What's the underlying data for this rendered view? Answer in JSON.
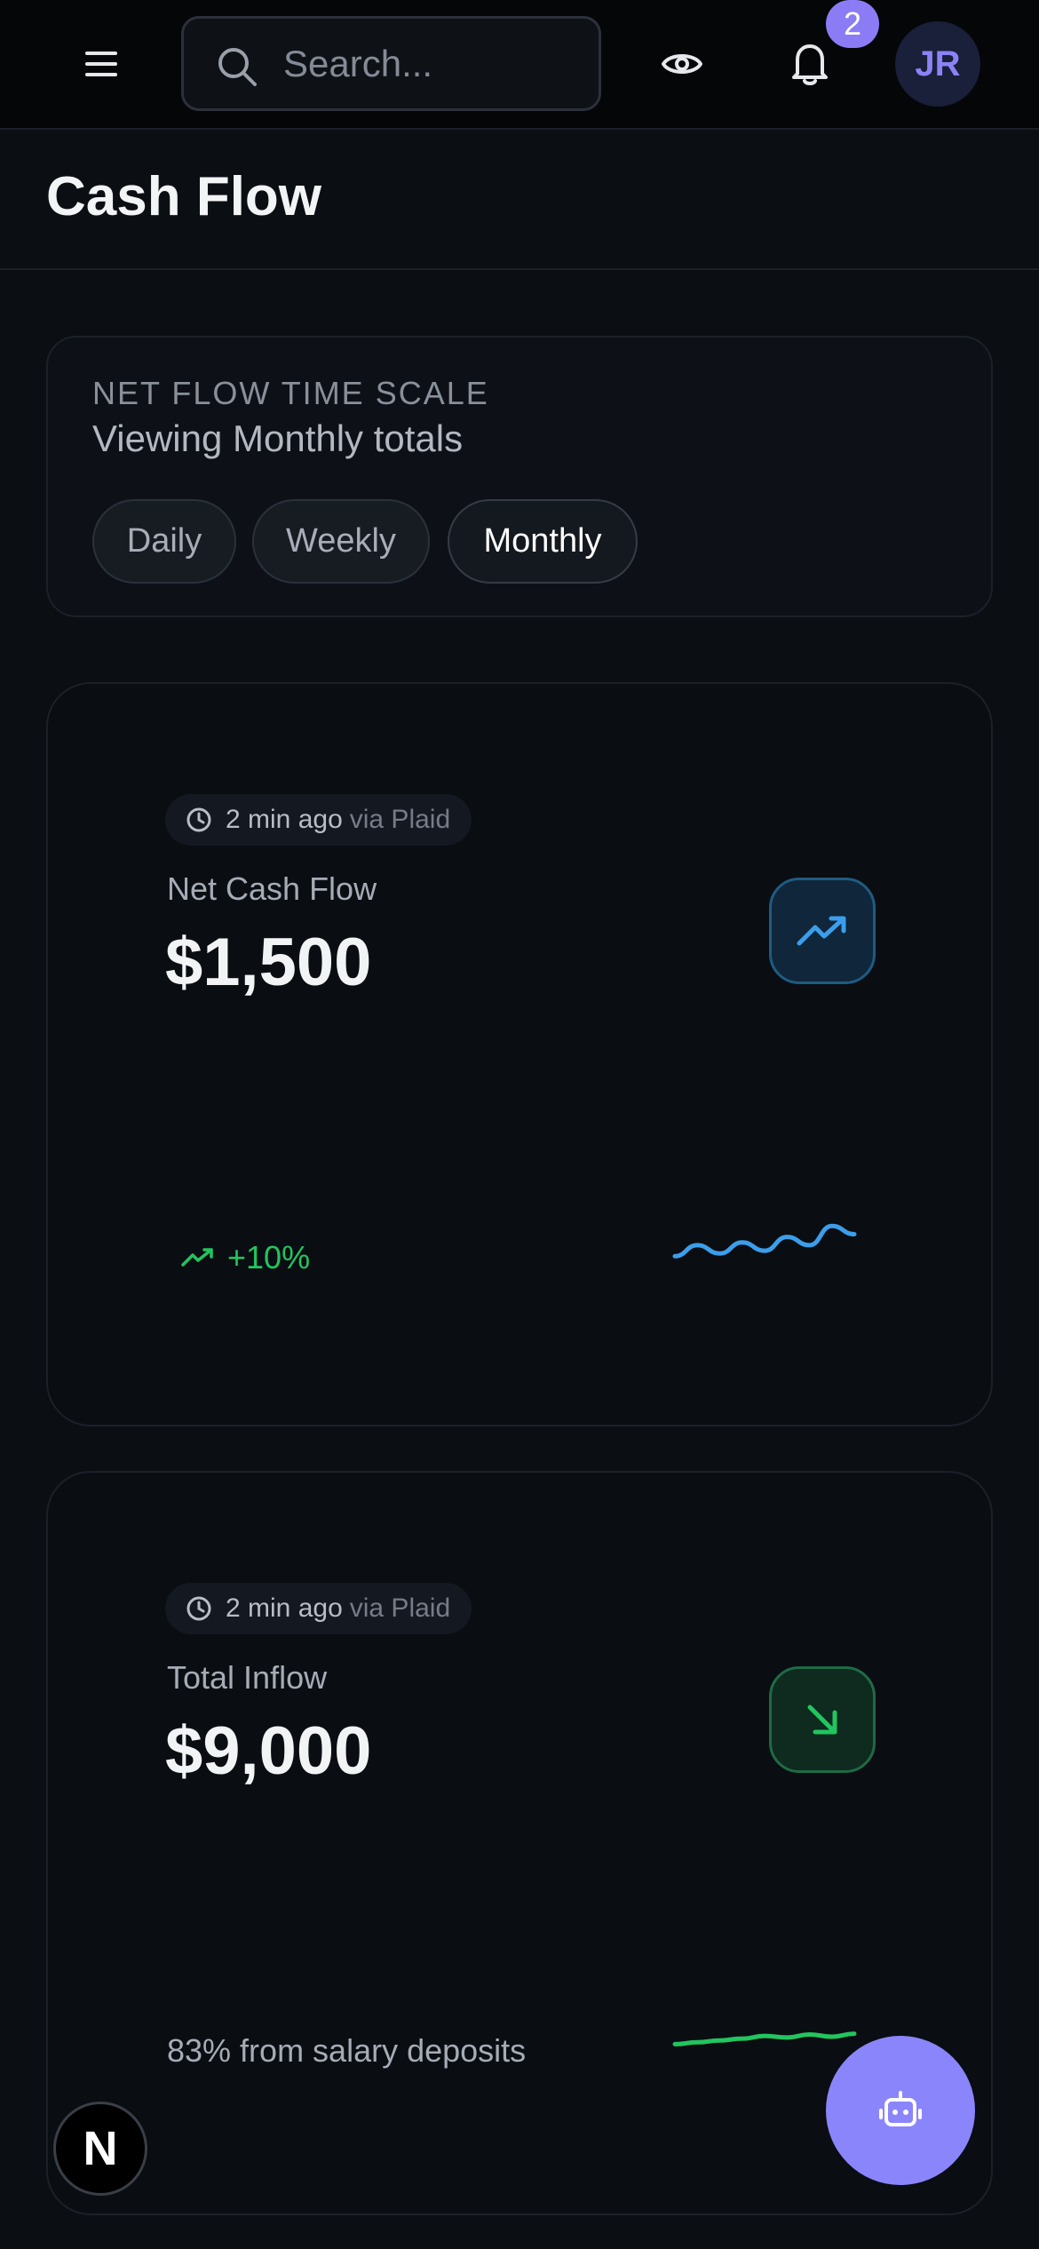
{
  "topbar": {
    "search_placeholder": "Search...",
    "notification_count": "2",
    "avatar_initials": "JR"
  },
  "header": {
    "title": "Cash Flow"
  },
  "time_scale": {
    "label": "NET FLOW TIME SCALE",
    "subtitle": "Viewing Monthly totals",
    "options": [
      "Daily",
      "Weekly",
      "Monthly"
    ],
    "selected": "Monthly"
  },
  "cards": [
    {
      "updated": "2 min ago",
      "source": "via Plaid",
      "label": "Net Cash Flow",
      "value": "$1,500",
      "icon": "trending-up-icon",
      "accent": "#3b9eea",
      "trend": "+10%",
      "trend_color": "#22c55e",
      "sparkline": [
        0.35,
        0.55,
        0.4,
        0.6,
        0.45,
        0.7,
        0.55,
        0.9,
        0.75
      ]
    },
    {
      "updated": "2 min ago",
      "source": "via Plaid",
      "label": "Total Inflow",
      "value": "$9,000",
      "icon": "arrow-down-right-icon",
      "accent": "#22c55e",
      "note": "83% from salary deposits",
      "sparkline": [
        0.3,
        0.35,
        0.4,
        0.45,
        0.52,
        0.48,
        0.56,
        0.5,
        0.58
      ]
    }
  ],
  "fab": {
    "n_label": "N",
    "assistant_icon": "robot-icon"
  }
}
